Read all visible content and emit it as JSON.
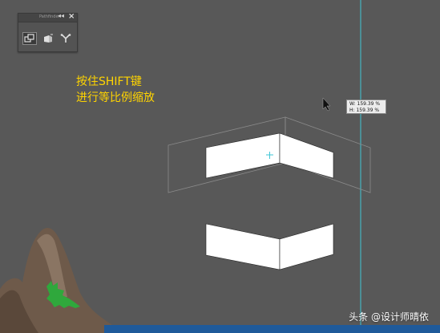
{
  "annotation": {
    "line1": "按住SHIFT键",
    "line2": "进行等比例缩放"
  },
  "transform_tooltip": {
    "width": "W: 159.39 %",
    "height": "H: 159.39 %"
  },
  "panel": {
    "title": "Pathfinder",
    "tools": [
      "object-group-icon",
      "perspective-icon",
      "merge-icon"
    ]
  },
  "watermark": "头条 @设计师晴依",
  "colors": {
    "canvas": "#585858",
    "guide": "#3fc6d6",
    "annotation": "#ffd400",
    "mountain": "#6e5a4a",
    "tree": "#2fa83c",
    "bottom_bar": "#1f5a9a"
  }
}
